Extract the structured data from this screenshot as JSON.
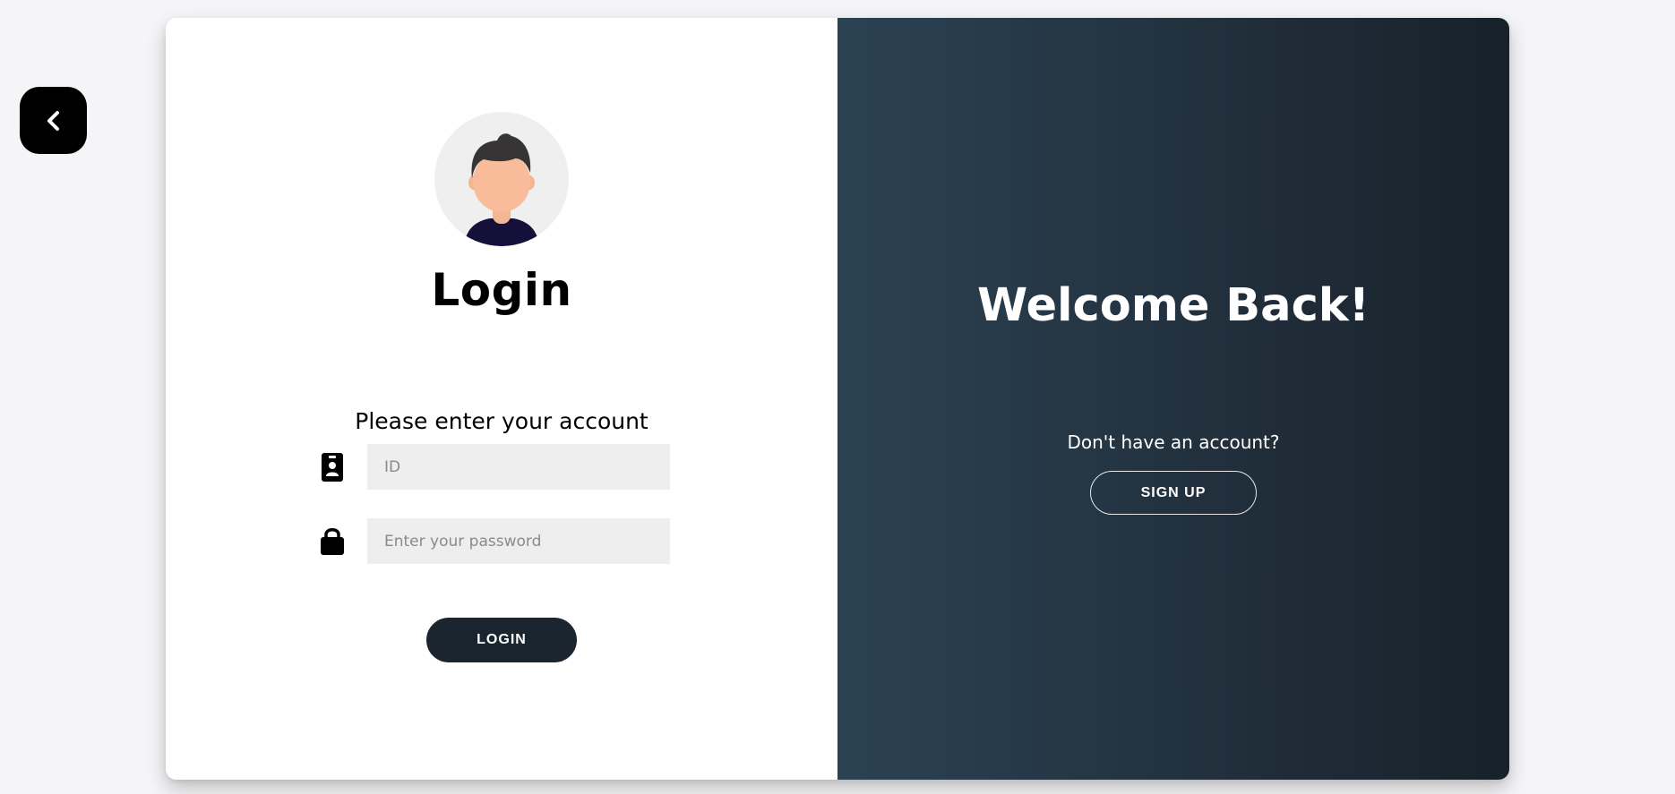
{
  "back_button": {
    "icon": "chevron-left-icon"
  },
  "login_panel": {
    "avatar_icon": "user-avatar-icon",
    "title": "Login",
    "subtitle": "Please enter your account",
    "id_field": {
      "icon": "id-badge-icon",
      "placeholder": "ID",
      "value": ""
    },
    "password_field": {
      "icon": "lock-icon",
      "placeholder": "Enter your password",
      "value": ""
    },
    "login_button": "LOGIN"
  },
  "welcome_panel": {
    "title": "Welcome Back!",
    "prompt": "Don't have an account?",
    "signup_button": "SIGN UP"
  },
  "colors": {
    "page_background": "#f5f5f7",
    "panel_dark": "#22303d",
    "button_dark": "#1b2530",
    "input_background": "#eeeeee"
  }
}
